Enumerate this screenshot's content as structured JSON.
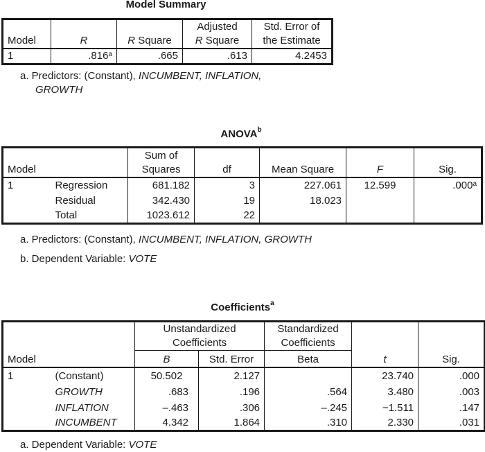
{
  "model_summary": {
    "title": "Model Summary",
    "headers": {
      "model": "Model",
      "r": "R",
      "r_square_it": "R",
      "r_square_rest": " Square",
      "adj_line1": "Adjusted",
      "adj_it": "R",
      "adj_rest": " Square",
      "se_line1": "Std. Error of",
      "se_line2": "the Estimate"
    },
    "row": {
      "model": "1",
      "r": ".816",
      "r_footnote": "a",
      "r_square": ".665",
      "adj_r_square": ".613",
      "std_error": "4.2453"
    },
    "notes": {
      "a_prefix": "a. Predictors: (Constant), ",
      "a_vars_line1": "INCUMBENT, INFLATION,",
      "a_vars_line2": "GROWTH"
    }
  },
  "anova": {
    "title": "ANOVA",
    "title_footnote": "b",
    "headers": {
      "model": "Model",
      "ss_line1": "Sum of",
      "ss_line2": "Squares",
      "df": "df",
      "ms": "Mean Square",
      "f": "F",
      "sig": "Sig."
    },
    "model_number": "1",
    "rows": [
      {
        "label": "Regression",
        "ss": "681.182",
        "df": "3",
        "ms": "227.061",
        "f": "12.599",
        "sig": ".000",
        "sig_footnote": "a"
      },
      {
        "label": "Residual",
        "ss": "342.430",
        "df": "19",
        "ms": "18.023",
        "f": "",
        "sig": "",
        "sig_footnote": ""
      },
      {
        "label": "Total",
        "ss": "1023.612",
        "df": "22",
        "ms": "",
        "f": "",
        "sig": "",
        "sig_footnote": ""
      }
    ],
    "notes": {
      "a_prefix": "a. Predictors: (Constant), ",
      "a_vars": "INCUMBENT, INFLATION, GROWTH",
      "b_prefix": "b. Dependent Variable: ",
      "b_var": "VOTE"
    }
  },
  "coefficients": {
    "title": "Coefficients",
    "title_footnote": "a",
    "headers": {
      "model": "Model",
      "unstd_line1": "Unstandardized",
      "unstd_line2": "Coefficients",
      "std_line1": "Standardized",
      "std_line2": "Coefficients",
      "b": "B",
      "se": "Std. Error",
      "beta": "Beta",
      "t": "t",
      "sig": "Sig."
    },
    "model_number": "1",
    "rows": [
      {
        "label": "(Constant)",
        "italic": false,
        "b": "50.502",
        "se": "2.127",
        "beta": "",
        "t": "23.740",
        "sig": ".000"
      },
      {
        "label": "GROWTH",
        "italic": true,
        "b": ".683",
        "se": ".196",
        "beta": ".564",
        "t": "3.480",
        "sig": ".003"
      },
      {
        "label": "INFLATION",
        "italic": true,
        "b": "–.463",
        "se": ".306",
        "beta": "–.245",
        "t": "−1.511",
        "sig": ".147"
      },
      {
        "label": "INCUMBENT",
        "italic": true,
        "b": "4.342",
        "se": "1.864",
        "beta": ".310",
        "t": "2.330",
        "sig": ".031"
      }
    ],
    "notes": {
      "a_prefix": "a. Dependent Variable: ",
      "a_var": "VOTE"
    }
  }
}
